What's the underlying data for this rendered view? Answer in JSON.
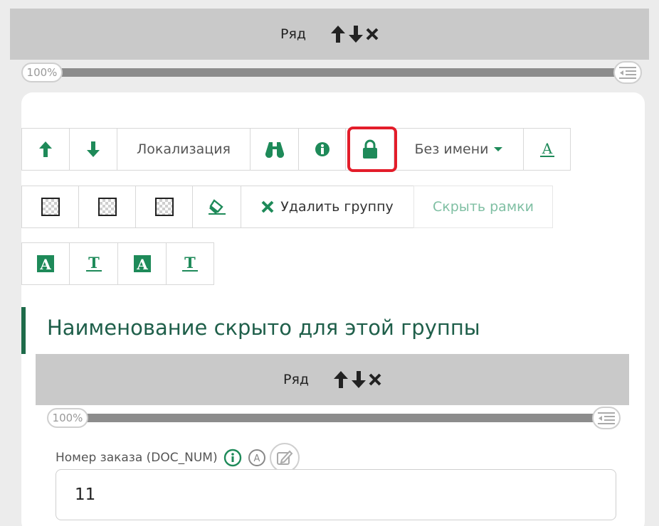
{
  "outer_row": {
    "label": "Ряд"
  },
  "outer_slider": {
    "percent_label": "100%",
    "value_percent": 100
  },
  "toolbar1": {
    "localization_label": "Локализация",
    "name_dropdown_label": "Без имени"
  },
  "toolbar2": {
    "delete_group_label": "Удалить группу",
    "hide_frames_label": "Скрыть рамки"
  },
  "group_heading": "Наименование скрыто для этой группы",
  "inner_row": {
    "label": "Ряд"
  },
  "inner_slider": {
    "percent_label": "100%",
    "value_percent": 100
  },
  "field": {
    "label": "Номер заказа (DOC_NUM)",
    "value": "11"
  },
  "colors": {
    "accent_green": "#1e8a59",
    "heading_green": "#1f5f4a",
    "highlight_red": "#e31d2a",
    "row_bar_gray": "#c9c9c9"
  },
  "icons": [
    "arrow-up-icon",
    "arrow-down-icon",
    "close-icon",
    "binoculars-icon",
    "info-icon",
    "lock-icon",
    "chevron-down-icon",
    "text-underline-icon",
    "eraser-icon",
    "text-bg-icon",
    "text-color-icon",
    "edit-icon",
    "outdent-icon"
  ]
}
